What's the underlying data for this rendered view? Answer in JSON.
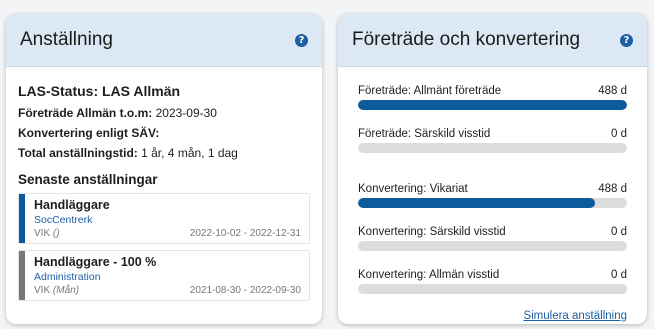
{
  "left_panel": {
    "title": "Anställning",
    "las_status": "LAS-Status: LAS Allmän",
    "lines": [
      {
        "label": "Företräde Allmän t.o.m:",
        "value": "2023-09-30"
      },
      {
        "label": "Konvertering enligt SÄV:",
        "value": ""
      },
      {
        "label": "Total anställningstid:",
        "value": "1 år, 4 mån, 1 dag"
      }
    ],
    "section_title": "Senaste anställningar",
    "cards": [
      {
        "title": "Handläggare",
        "link": "SocCentrerk",
        "type": "VIK",
        "note": "()",
        "dates": "2022-10-02 - 2022-12-31",
        "color": "#0d5a9c"
      },
      {
        "title": "Handläggare - 100 %",
        "link": "Administration",
        "type": "VIK",
        "note": "(Mån)",
        "dates": "2021-08-30 - 2022-09-30",
        "color": "#777777"
      }
    ]
  },
  "right_panel": {
    "title": "Företräde och konvertering",
    "stats": [
      {
        "label": "Företräde: Allmänt företräde",
        "value": "488 d",
        "fill": 1.0
      },
      {
        "label": "Företräde: Särskild visstid",
        "value": "0 d",
        "fill": 0.0
      },
      {
        "label": "Konvertering: Vikariat",
        "value": "488 d",
        "fill": 0.88
      },
      {
        "label": "Konvertering: Särskild visstid",
        "value": "0 d",
        "fill": 0.0
      },
      {
        "label": "Konvertering: Allmän visstid",
        "value": "0 d",
        "fill": 0.0
      }
    ],
    "simulate_link": "Simulera anställning"
  },
  "icons": {
    "help": "question-circle-icon"
  },
  "colors": {
    "accent": "#0d5a9c",
    "header_bg": "#dce8f4",
    "track": "#dcdcdc"
  }
}
